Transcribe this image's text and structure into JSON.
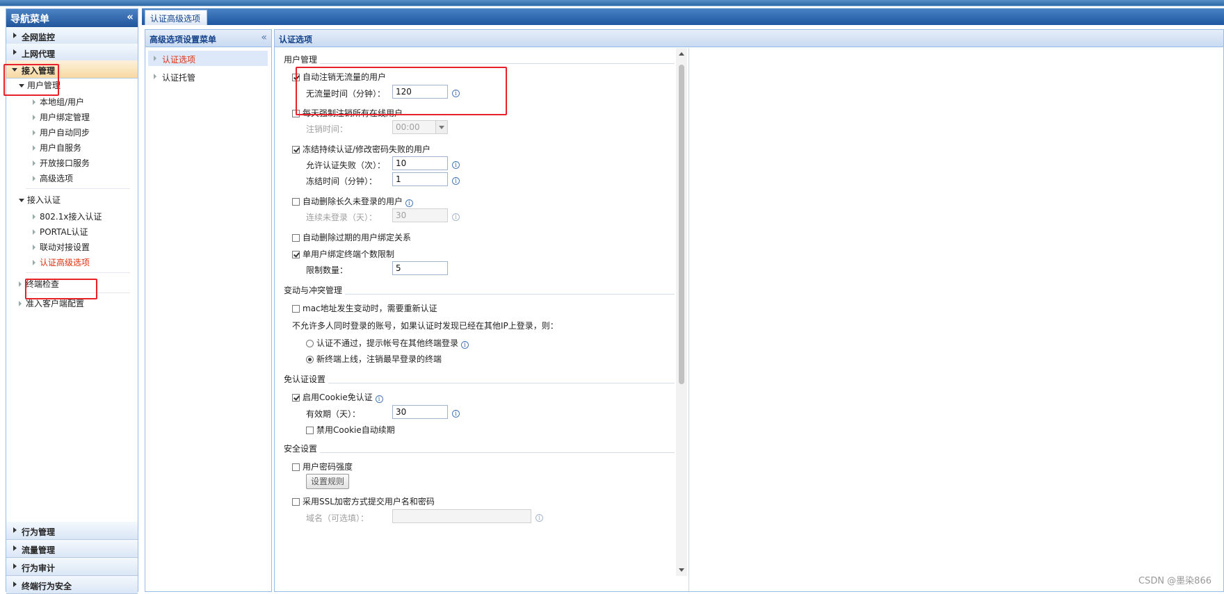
{
  "nav": {
    "title": "导航菜单",
    "collapse_icon": "«",
    "sections_top": [
      "全网监控",
      "上网代理",
      "接入管理"
    ],
    "user_mgmt": {
      "title": "用户管理",
      "items": [
        "本地组/用户",
        "用户绑定管理",
        "用户自动同步",
        "用户自服务",
        "开放接口服务",
        "高级选项"
      ]
    },
    "access_auth": {
      "title": "接入认证",
      "items": [
        "802.1x接入认证",
        "PORTAL认证",
        "联动对接设置",
        "认证高级选项"
      ]
    },
    "more_items": [
      "终端检查",
      "准入客户端配置"
    ],
    "sections_bottom": [
      "行为管理",
      "流量管理",
      "行为审计",
      "终端行为安全"
    ]
  },
  "tabs": [
    {
      "label": "认证高级选项"
    }
  ],
  "menu2": {
    "title": "高级选项设置菜单",
    "collapse_icon": "«",
    "items": [
      "认证选项",
      "认证托管"
    ]
  },
  "panel": {
    "title": "认证选项",
    "user_mgmt": {
      "title": "用户管理",
      "auto_logout_noflow": {
        "label": "自动注销无流量的用户",
        "checked": true
      },
      "noflow_time": {
        "label": "无流量时间（分钟）：",
        "value": "120"
      },
      "force_logout_daily": {
        "label": "每天强制注销所有在线用户",
        "checked": false
      },
      "logout_time": {
        "label": "注销时间：",
        "value": "00:00"
      },
      "freeze_failed": {
        "label": "冻结持续认证/修改密码失败的用户",
        "checked": true
      },
      "allow_fail": {
        "label": "允许认证失败（次）：",
        "value": "10"
      },
      "freeze_time": {
        "label": "冻结时间（分钟）：",
        "value": "1"
      },
      "auto_delete_inactive": {
        "label": "自动删除长久未登录的用户",
        "checked": false
      },
      "inactive_days": {
        "label": "连续未登录（天）：",
        "value": "30"
      },
      "auto_delete_expired_bind": {
        "label": "自动删除过期的用户绑定关系",
        "checked": false
      },
      "bind_limit": {
        "label": "单用户绑定终端个数限制",
        "checked": true
      },
      "limit_count": {
        "label": "限制数量：",
        "value": "5"
      }
    },
    "change_conflict": {
      "title": "变动与冲突管理",
      "mac_change": {
        "label": "mac地址发生变动时，需要重新认证",
        "checked": false
      },
      "multi_login_desc": "不允许多人同时登录的账号，如果认证时发现已经在其他IP上登录，则：",
      "opt_reject": {
        "label": "认证不通过，提示帐号在其他终端登录",
        "checked": false
      },
      "opt_new_online": {
        "label": "新终端上线，注销最早登录的终端",
        "checked": true
      }
    },
    "no_auth": {
      "title": "免认证设置",
      "cookie": {
        "label": "启用Cookie免认证",
        "checked": true
      },
      "validity": {
        "label": "有效期（天）：",
        "value": "30"
      },
      "disable_renew": {
        "label": "禁用Cookie自动续期",
        "checked": false
      }
    },
    "security": {
      "title": "安全设置",
      "pwd_strength": {
        "label": "用户密码强度",
        "checked": false
      },
      "set_rules": "设置规则",
      "ssl": {
        "label": "采用SSL加密方式提交用户名和密码",
        "checked": false
      },
      "domain": {
        "label": "域名（可选填）：",
        "value": ""
      }
    }
  },
  "watermark": "CSDN @墨染866",
  "colors": {
    "accent": "#15428b",
    "active_item": "#e03010",
    "highlight_box": "#e8202a"
  }
}
